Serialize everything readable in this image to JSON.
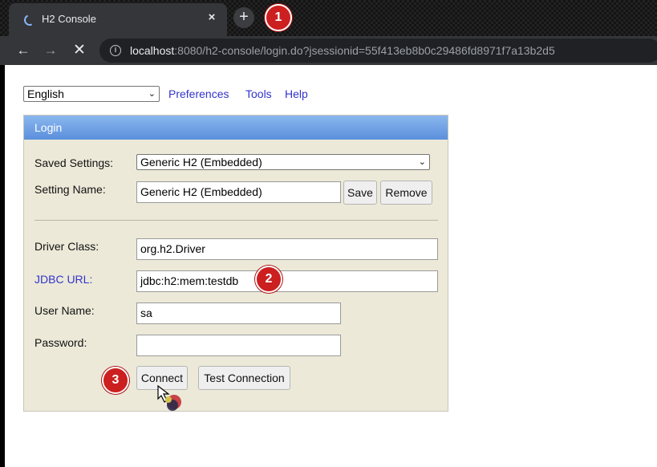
{
  "browser": {
    "tab_title": "H2 Console",
    "tab_close": "×",
    "new_tab": "+",
    "url_host": "localhost",
    "url_rest": ":8080/h2-console/login.do?jsessionid=55f413eb8b0c29486fd8971f7a13b2d5"
  },
  "header": {
    "language": "English",
    "links": [
      "Preferences",
      "Tools",
      "Help"
    ]
  },
  "login": {
    "title": "Login",
    "saved_settings_label": "Saved Settings:",
    "saved_settings_value": "Generic H2 (Embedded)",
    "setting_name_label": "Setting Name:",
    "setting_name_value": "Generic H2 (Embedded)",
    "save_label": "Save",
    "remove_label": "Remove",
    "driver_class_label": "Driver Class:",
    "driver_class_value": "org.h2.Driver",
    "jdbc_url_label": "JDBC URL:",
    "jdbc_url_value": "jdbc:h2:mem:testdb",
    "user_name_label": "User Name:",
    "user_name_value": "sa",
    "password_label": "Password:",
    "password_value": "",
    "connect_label": "Connect",
    "test_connection_label": "Test Connection"
  },
  "steps": [
    "1",
    "2",
    "3"
  ],
  "colors": {
    "accent_link": "#3333cc",
    "header_blue": "#5b8fdc",
    "panel_bg": "#ece9d8",
    "badge_red": "#cc1f1f"
  },
  "icons": [
    "loading-spinner-icon",
    "close-icon",
    "plus-icon",
    "back-arrow-icon",
    "forward-arrow-icon",
    "stop-icon",
    "info-icon",
    "chevron-down-icon",
    "cursor-icon"
  ]
}
